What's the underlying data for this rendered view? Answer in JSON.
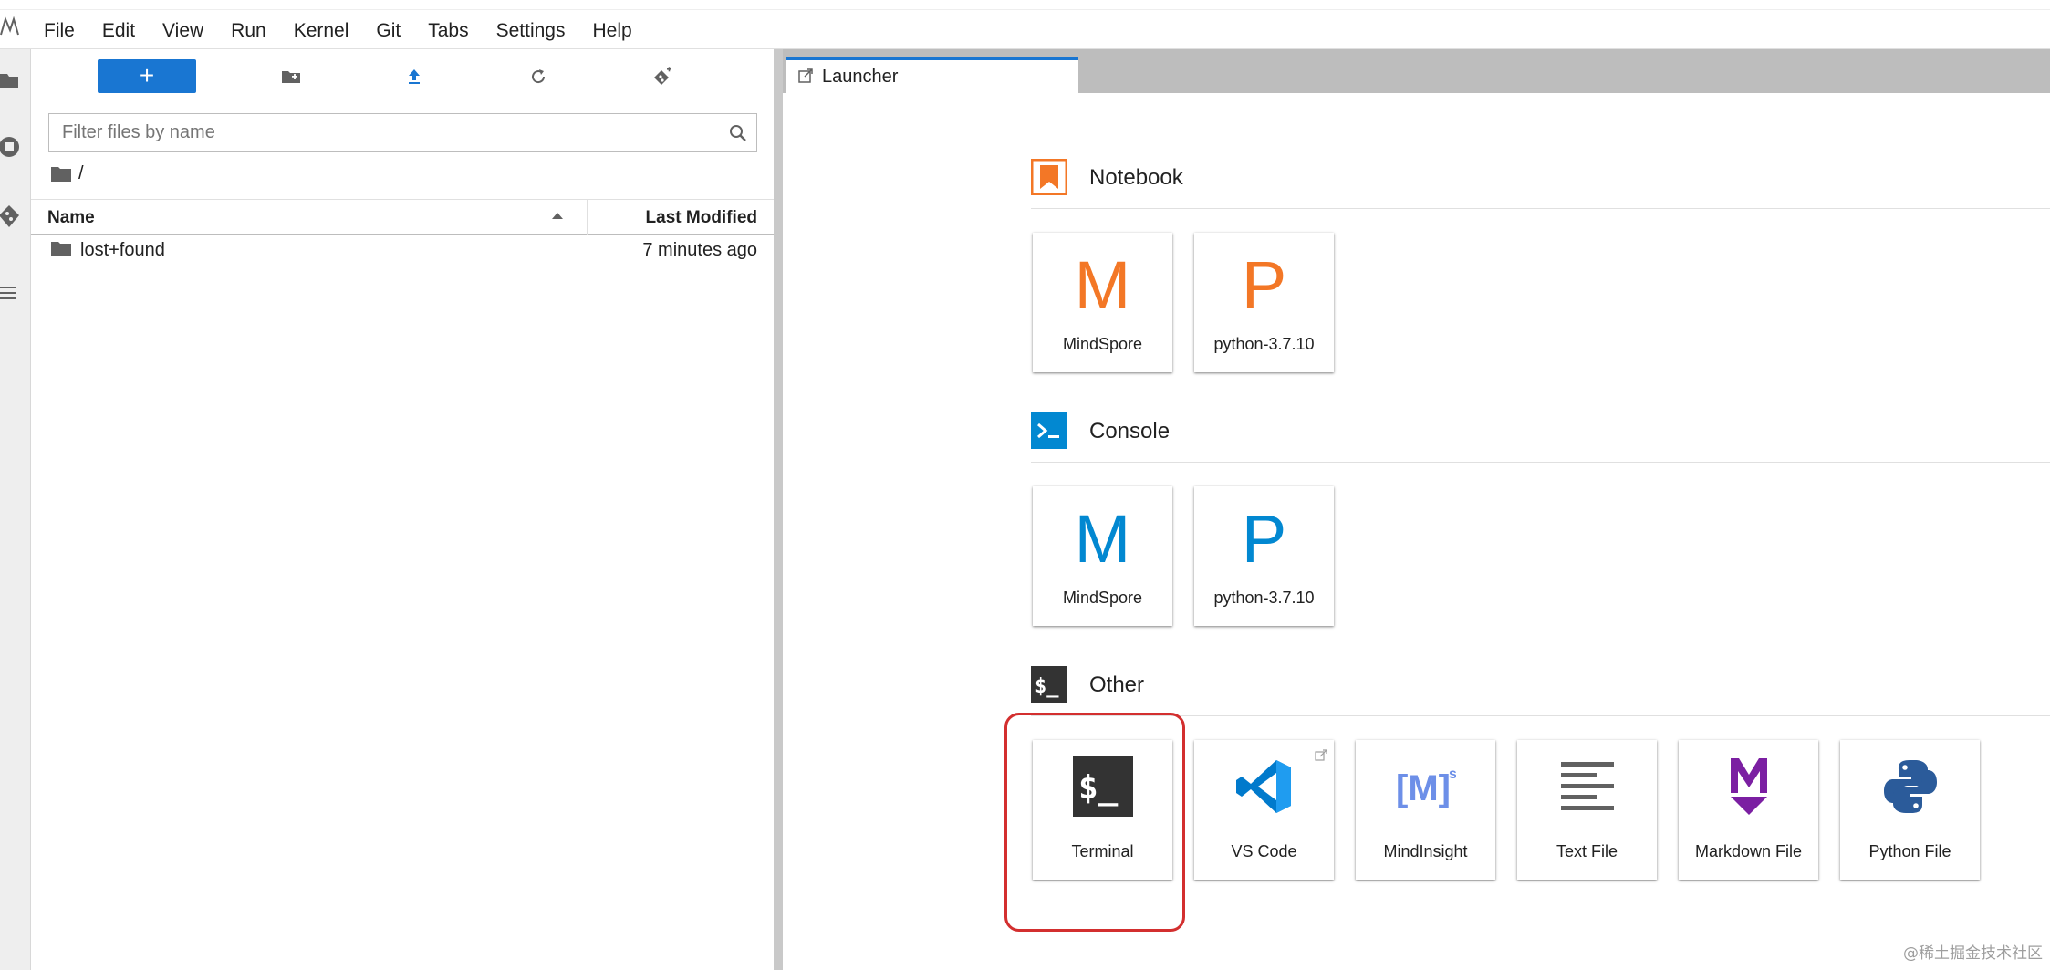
{
  "menu": {
    "items": [
      "File",
      "Edit",
      "View",
      "Run",
      "Kernel",
      "Git",
      "Tabs",
      "Settings",
      "Help"
    ]
  },
  "activity_bar": {
    "icons": [
      "folder-icon",
      "running-icon",
      "git-icon",
      "toc-icon"
    ]
  },
  "file_browser": {
    "new_button_label": "+",
    "filter_placeholder": "Filter files by name",
    "breadcrumb": "/",
    "columns": {
      "name": "Name",
      "last_modified": "Last Modified"
    },
    "rows": [
      {
        "name": "lost+found",
        "modified": "7 minutes ago"
      }
    ]
  },
  "tabs": [
    {
      "label": "Launcher",
      "active": true
    }
  ],
  "launcher": {
    "sections": [
      {
        "title": "Notebook",
        "cards": [
          {
            "letter": "M",
            "label": "MindSpore"
          },
          {
            "letter": "P",
            "label": "python-3.7.10"
          }
        ]
      },
      {
        "title": "Console",
        "cards": [
          {
            "letter": "M",
            "label": "MindSpore"
          },
          {
            "letter": "P",
            "label": "python-3.7.10"
          }
        ]
      },
      {
        "title": "Other",
        "cards": [
          {
            "label": "Terminal",
            "icon": "terminal-icon"
          },
          {
            "label": "VS Code",
            "icon": "vscode-icon"
          },
          {
            "label": "MindInsight",
            "icon": "mindinsight-icon"
          },
          {
            "label": "Text File",
            "icon": "text-file-icon"
          },
          {
            "label": "Markdown File",
            "icon": "markdown-icon"
          },
          {
            "label": "Python File",
            "icon": "python-icon"
          }
        ]
      }
    ]
  },
  "colors": {
    "accent": "#1976d2",
    "notebook_orange": "#f37726",
    "console_blue": "#0288d1",
    "highlight_red": "#d32f2f",
    "markdown_purple": "#7b1fa2"
  },
  "watermark": "@稀土掘金技术社区"
}
